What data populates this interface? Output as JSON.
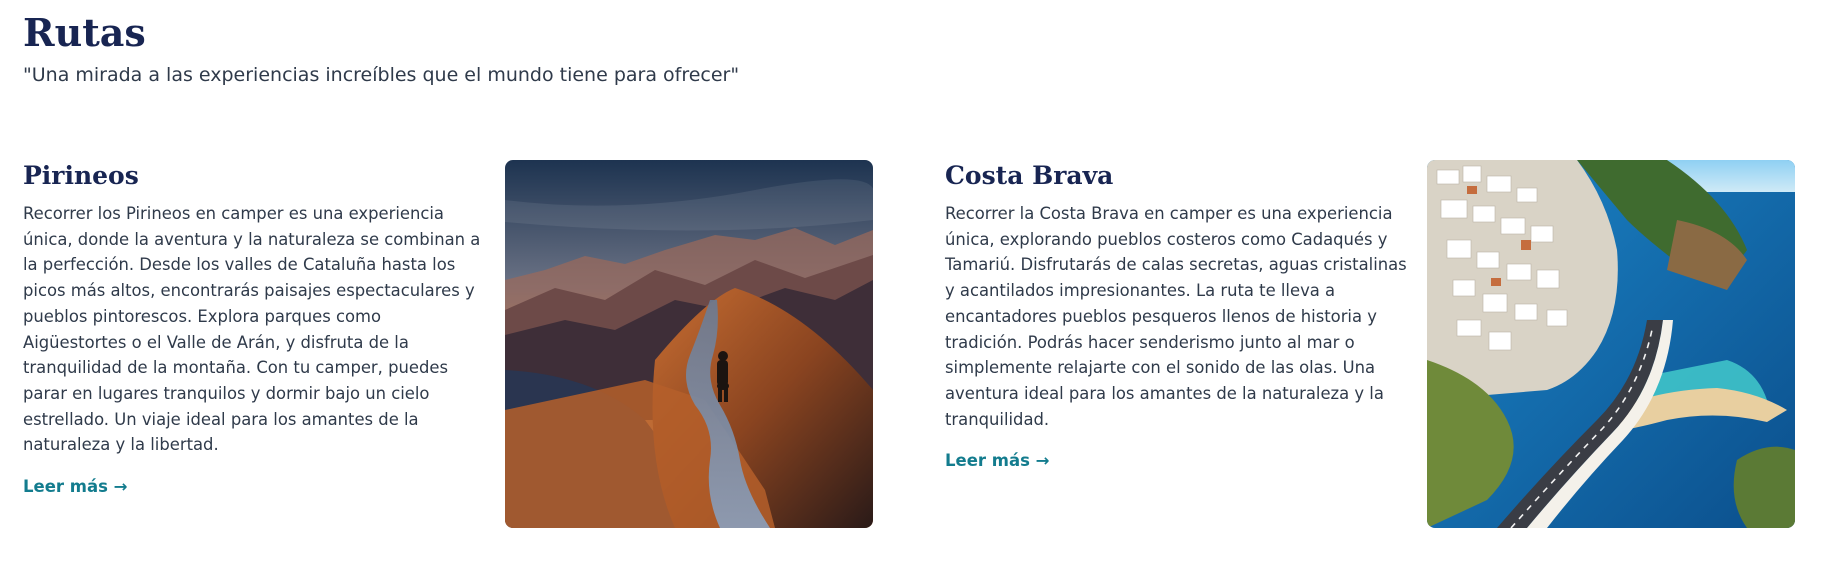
{
  "header": {
    "title": "Rutas",
    "subtitle": "\"Una mirada a las experiencias increíbles que el mundo tiene para ofrecer\""
  },
  "routes": [
    {
      "title": "Pirineos",
      "description": "Recorrer los Pirineos en camper es una experiencia única, donde la aventura y la naturaleza se combinan a la perfección. Desde los valles de Cataluña hasta los picos más altos, encontrarás paisajes espectaculares y pueblos pintorescos. Explora parques como Aigüestortes o el Valle de Arán, y disfruta de la tranquilidad de la montaña. Con tu camper, puedes parar en lugares tranquilos y dormir bajo un cielo estrellado. Un viaje ideal para los amantes de la naturaleza y la libertad.",
      "link_label": "Leer más →"
    },
    {
      "title": "Costa Brava",
      "description": "Recorrer la Costa Brava en camper es una experiencia única, explorando pueblos costeros como Cadaqués y Tamariú. Disfrutarás de calas secretas, aguas cristalinas y acantilados impresionantes. La ruta te lleva a encantadores pueblos pesqueros llenos de historia y tradición. Podrás hacer senderismo junto al mar o simplemente relajarte con el sonido de las olas. Una aventura ideal para los amantes de la naturaleza y la tranquilidad.",
      "link_label": "Leer más →"
    }
  ],
  "colors": {
    "heading": "#182552",
    "body_text": "#2f3a4a",
    "link": "#137c8e"
  }
}
